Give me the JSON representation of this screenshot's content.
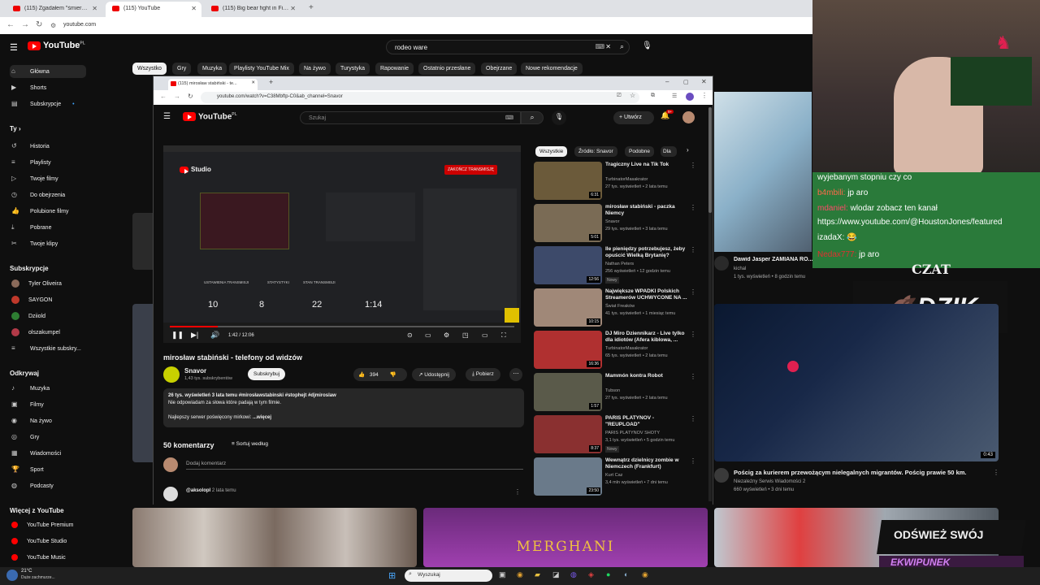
{
  "browser": {
    "tabs": [
      {
        "title": "(115) Zgadałem \"śmierć\" Hitler..."
      },
      {
        "title": "(115) YouTube"
      },
      {
        "title": "(115) Big bear fight in Finland"
      }
    ],
    "url": "youtube.com"
  },
  "yt": {
    "logo": "YouTube",
    "logo_region": "PL",
    "search_value": "rodeo ware",
    "chips": [
      "Wszystko",
      "Gry",
      "Muzyka",
      "Playlisty YouTube Mix",
      "Na żywo",
      "Turystyka",
      "Rapowanie",
      "Ostatnio przesłane",
      "Obejrzane",
      "Nowe rekomendacje"
    ],
    "sidebar": {
      "main": [
        {
          "label": "Główna",
          "icon": "home-icon"
        },
        {
          "label": "Shorts",
          "icon": "shorts-icon"
        },
        {
          "label": "Subskrypcje",
          "icon": "subscriptions-icon"
        }
      ],
      "you_header": "Ty",
      "you": [
        {
          "label": "Historia"
        },
        {
          "label": "Playlisty"
        },
        {
          "label": "Twoje filmy"
        },
        {
          "label": "Do obejrzenia"
        },
        {
          "label": "Polubione filmy"
        },
        {
          "label": "Pobrane"
        },
        {
          "label": "Twoje klipy"
        }
      ],
      "subs_header": "Subskrypcje",
      "subs": [
        {
          "label": "Tyler Oliveira",
          "color": "#8a6a5a"
        },
        {
          "label": "SAYGON",
          "color": "#c0392b"
        },
        {
          "label": "Dziiold",
          "color": "#2e7d32"
        },
        {
          "label": "olszakumpel",
          "color": "#b23a48"
        },
        {
          "label": "Wszystkie subskry..."
        }
      ],
      "explore_header": "Odkrywaj",
      "explore": [
        {
          "label": "Muzyka"
        },
        {
          "label": "Filmy"
        },
        {
          "label": "Na żywo"
        },
        {
          "label": "Gry"
        },
        {
          "label": "Wiadomości"
        },
        {
          "label": "Sport"
        },
        {
          "label": "Podcasty"
        }
      ],
      "more_header": "Więcej z YouTube",
      "more": [
        {
          "label": "YouTube Premium"
        },
        {
          "label": "YouTube Studio"
        },
        {
          "label": "YouTube Music"
        }
      ]
    }
  },
  "inner": {
    "tab_title": "(115) mirosław stabiński - te...",
    "url": "youtube.com/watch?v=C38Mbftp-C0&ab_channel=Snavor",
    "search_placeholder": "Szukaj",
    "create_label": "Utwórz",
    "notif_count": "9+",
    "video": {
      "time": "1:42 / 12:06",
      "progress": 0.14,
      "title": "mirosław stabiński - telefony od widzów",
      "channel": "Snavor",
      "subs": "1,43 tys. subskrybentów",
      "subscribe": "Subskrybuj",
      "likes": "394",
      "share": "Udostępnij",
      "download": "Pobierz",
      "views_date": "26 tys. wyświetleń  3 lata temu  #mirosławstabinski #stophejt #djmiroslaw",
      "desc1": "Nie odpowiadam za słowa które padają w tym filmie.",
      "desc2": "Najlepszy serwer poświęcony mirkowi:",
      "more": "...więcej",
      "comments_count": "50 komentarzy",
      "sort": "Sortuj według",
      "add_comment": "Dodaj komentarz",
      "first_comment_author": "@aksolopl",
      "first_comment_time": "2 lata temu"
    },
    "studio": {
      "label": "Studio",
      "stats": [
        "10",
        "8",
        "22",
        "1:14"
      ],
      "tabs": [
        "USTAWIENIA TRANSMISJI",
        "STATYSTYKI",
        "STAN TRANSMISJI"
      ],
      "end_btn": "ZAKOŃCZ TRANSMISJĘ"
    },
    "filter_chips": [
      "Wszystkie",
      "Źródło: Snavor",
      "Podobne",
      "Dla"
    ],
    "related": [
      {
        "title": "Tragiczny Live na Tik Tok",
        "channel": "TurbinatorMasakrator",
        "meta": "27 tys. wyświetleń • 2 lata temu",
        "dur": "6:31",
        "color": "#6b5a3a"
      },
      {
        "title": "mirosław stabiński - paczka Niemcy",
        "channel": "Snavor",
        "meta": "29 tys. wyświetleń • 3 lata temu",
        "dur": "5:01",
        "color": "#7a6b55"
      },
      {
        "title": "Ile pieniędzy potrzebujesz, żeby opuścić Wielką Brytanię?",
        "channel": "Nathan Peters",
        "meta": "256 wyświetleń • 12 godzin temu",
        "dur": "12:56",
        "color": "#3d4a6a",
        "new": "Nowy"
      },
      {
        "title": "Największe WPADKI Polskich Streamerów UCHWYCONE NA ...",
        "channel": "Świat Freaków",
        "meta": "41 tys. wyświetleń • 1 miesiąc temu",
        "dur": "10:15",
        "color": "#a08878"
      },
      {
        "title": "DJ Miro Dziennikarz - Live tylko dla idiotów (Afera kiblowa, ...",
        "channel": "TurbinatorMasakrator",
        "meta": "65 tys. wyświetleń • 2 lata temu",
        "dur": "16:36",
        "color": "#b03030"
      },
      {
        "title": "Mammón kontra Robot",
        "channel": "Tubson",
        "meta": "27 tys. wyświetleń • 2 lata temu",
        "dur": "1:57",
        "color": "#5a5a4a"
      },
      {
        "title": "PARIS PLATYNOV - \"REUPLOAD\"",
        "channel": "PARIS PLATYNOV SHOTY",
        "meta": "3,1 tys. wyświetleń • 5 godzin temu",
        "dur": "8:37",
        "color": "#8a3030",
        "new": "Nowy"
      },
      {
        "title": "Wewnątrz dzielnicy zombie w Niemczech (Frankfurt)",
        "channel": "Kurt Caz",
        "meta": "3,4 mln wyświetleń • 7 dni temu",
        "dur": "23:50",
        "color": "#6a7a8a"
      }
    ]
  },
  "right": {
    "video1_title": "Dawid Jasper ZAMIANA RO...",
    "video1_channel": "kichal",
    "video1_meta": "1 tys. wyświetleń • 8 godzin temu",
    "video2_title": "Pościg za kurierem przewożącym nielegalnych migrantów. Pościg prawie 50 km.",
    "video2_channel": "Niezależny Serwis Wiadomości 2",
    "video2_meta": "660 wyświetleń • 3 dni temu",
    "video2_dur": "0:43",
    "chat": [
      {
        "text": "wyjebanym stopniu czy co"
      },
      {
        "user": "b4mbili:",
        "text": "jp aro"
      },
      {
        "user": "mdaniel:",
        "text": "wlodar zobacz ten kanał"
      },
      {
        "text": "https://www.youtube.com/@HoustonJones/featured"
      },
      {
        "user": "izadaX:",
        "text": "😂"
      },
      {
        "user": "Nedax777:",
        "text": "jp aro"
      }
    ],
    "czat_label": "CZAT",
    "brand": "DZIK",
    "promo1": "ODŚWIEŻ SWÓJ",
    "promo2": "EKWIPUNEK"
  },
  "bottom_thumb_text": "MERGHANI",
  "taskbar": {
    "weather": "21°C",
    "weather_sub": "Duże zachmurze...",
    "search": "Wyszukaj"
  }
}
